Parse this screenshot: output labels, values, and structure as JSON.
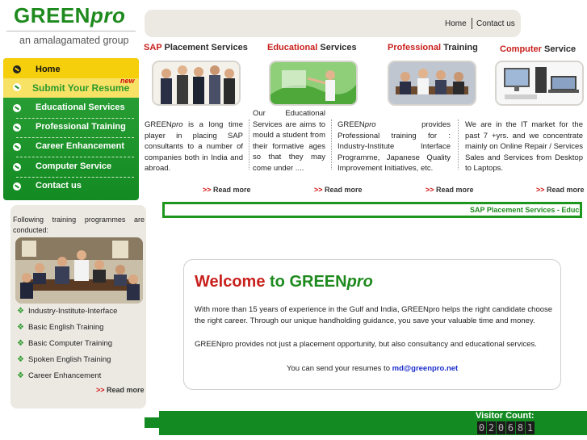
{
  "logo": {
    "brand_main": "GREEN",
    "brand_italic": "pro",
    "tagline": "an amalagamated group"
  },
  "topnav": {
    "home": "Home",
    "contact": "Contact us"
  },
  "menu": {
    "items": [
      {
        "label": "Home"
      },
      {
        "label": "Submit Your Resume",
        "badge": "new"
      },
      {
        "label": "Educational Services"
      },
      {
        "label": "Professional Training"
      },
      {
        "label": "Career Enhancement"
      },
      {
        "label": "Computer Service"
      },
      {
        "label": "Contact us"
      }
    ]
  },
  "training": {
    "intro": "Following training programmes are conducted:",
    "items": [
      "Industry-Institute-Interface",
      "Basic English Training",
      "Basic Computer Training",
      "Spoken English Training",
      "Career Enhancement"
    ],
    "read_more": "Read more",
    "read_more_arrow": ">>"
  },
  "services": [
    {
      "title_red": "SAP",
      "title_dark": " Placement Services",
      "text_brand": "GREEN",
      "text_brand_it": "pro",
      "text": " is a long time player in placing SAP consultants to a number of companies both in India and abroad.",
      "read_more": "Read more"
    },
    {
      "title_red": "Educational",
      "title_dark": " Services",
      "text": "Our Educational Services are aims to mould a student from their formative ages so that they may come under ....",
      "read_more": "Read more"
    },
    {
      "title_red": "Professional",
      "title_dark": " Training",
      "text_brand": "GREEN",
      "text_brand_it": "pro",
      "text": " provides Professional training for : Industry-Institute Interface Programme, Japanese Quality Improvement Initiatives, etc.",
      "read_more": "Read more"
    },
    {
      "title_red": "Computer",
      "title_dark": " Service",
      "text": "We are in the IT market for the past 7 +yrs. and we concentrate mainly on Online Repair / Services Sales and Services from Desktop to Laptops.",
      "read_more": "Read more"
    }
  ],
  "marquee": {
    "text": "SAP Placement Services - Educ"
  },
  "welcome": {
    "title_1": "Welcome",
    "title_2": " to ",
    "title_3": "GREEN",
    "title_4": "pro",
    "para1": "With more than 15 years of experience in the Gulf and India, GREENpro helps the right candidate choose the right career. Through our unique handholding guidance, you save your valuable time and money.",
    "para2": "GREENpro provides not just a placement opportunity, but also consultancy and educational services.",
    "mail_text": "You can send your resumes to ",
    "mail_address": "md@greenpro.net"
  },
  "footer": {
    "visitor_label": "Visitor Count:",
    "digits": [
      "0",
      "2",
      "0",
      "6",
      "8",
      "1"
    ]
  },
  "colors": {
    "brand_green": "#1e8a1e",
    "accent_red": "#c8201c",
    "menu_yellow": "#f5ce0c"
  }
}
